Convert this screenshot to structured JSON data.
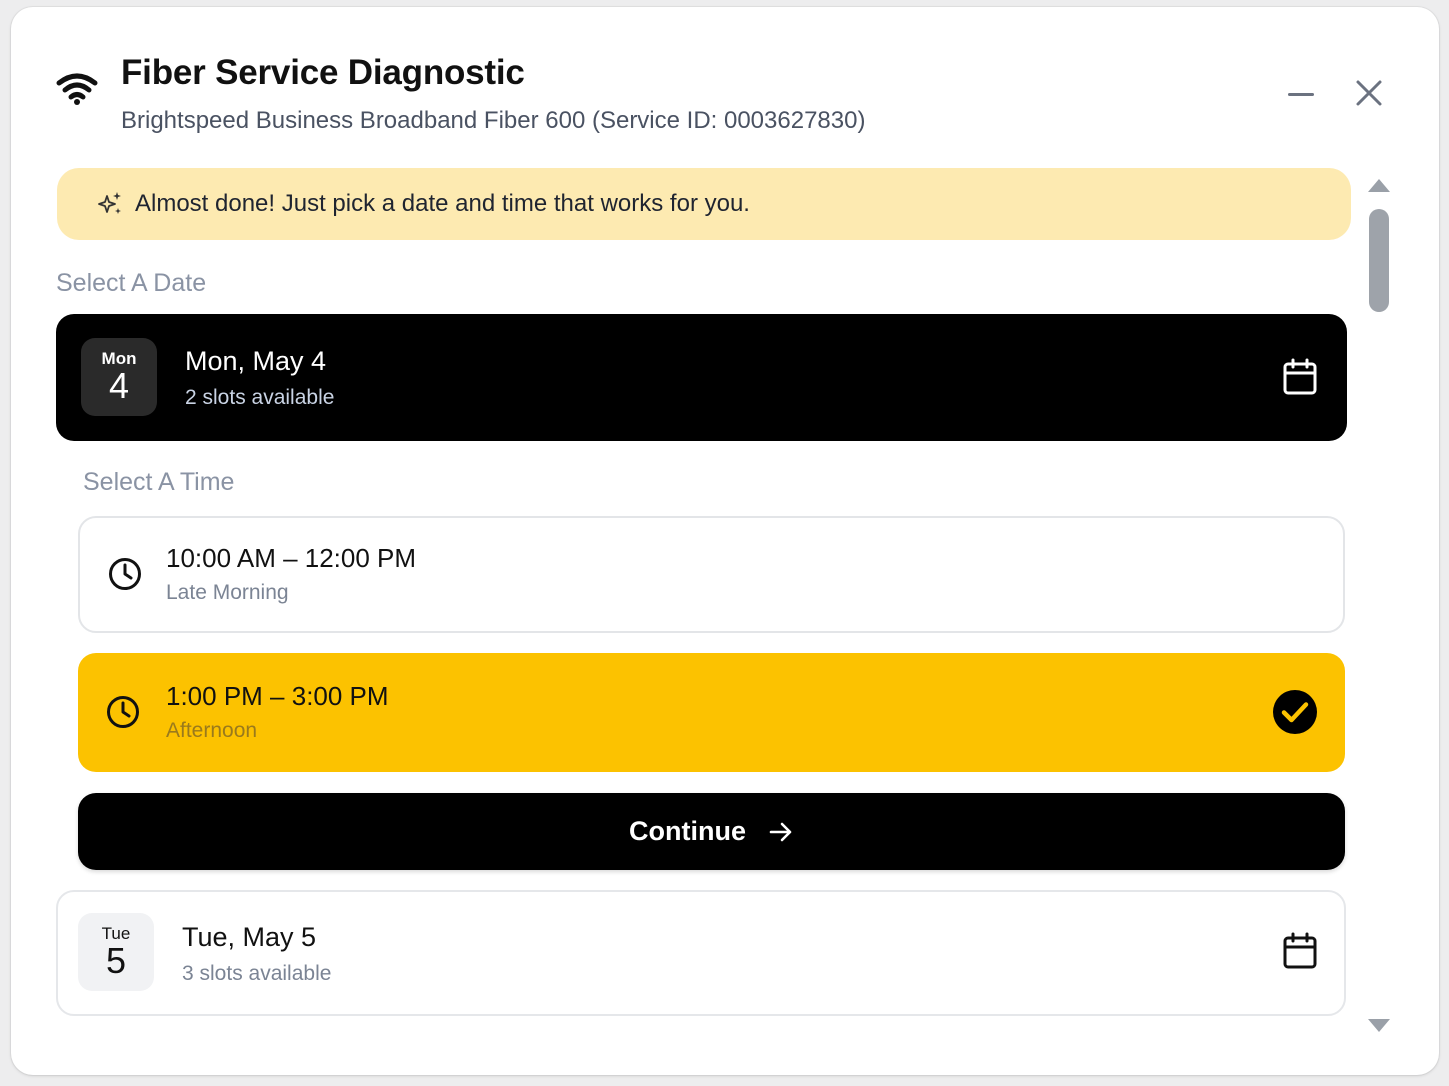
{
  "header": {
    "title": "Fiber Service Diagnostic",
    "subtitle": "Brightspeed Business Broadband Fiber 600 (Service ID: 0003627830)",
    "icon": "wifi-icon"
  },
  "banner": {
    "text": "Almost done! Just pick a date and time that works for you.",
    "icon": "sparkle-icon",
    "color": "#fdeab1"
  },
  "date_section": {
    "label": "Select A Date",
    "dates": [
      {
        "dow": "Mon",
        "day": "4",
        "title": "Mon, May 4",
        "slots_text": "2 slots available",
        "selected": true
      },
      {
        "dow": "Tue",
        "day": "5",
        "title": "Tue, May 5",
        "slots_text": "3 slots available",
        "selected": false
      }
    ]
  },
  "time_section": {
    "label": "Select A Time",
    "slots": [
      {
        "time": "10:00 AM – 12:00 PM",
        "label": "Late Morning",
        "selected": false
      },
      {
        "time": "1:00 PM – 3:00 PM",
        "label": "Afternoon",
        "selected": true
      }
    ]
  },
  "continue_button": {
    "label": "Continue"
  },
  "colors": {
    "accent": "#fcc200",
    "dark": "#000000"
  }
}
